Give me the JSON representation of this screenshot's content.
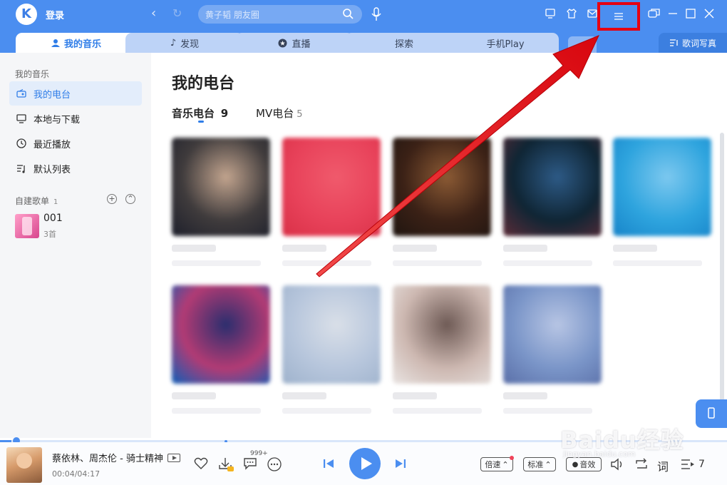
{
  "app": {
    "logo_letter": "K",
    "login_label": "登录"
  },
  "search": {
    "placeholder": "黄子韬 朋友圈"
  },
  "tabs": [
    {
      "label": "我的音乐",
      "active": true
    },
    {
      "label": "发现"
    },
    {
      "label": "直播"
    },
    {
      "label": "探索"
    },
    {
      "label": "手机Play"
    }
  ],
  "lyric_writing_label": "歌词写真",
  "sidebar": {
    "section_title": "我的音乐",
    "items": [
      {
        "label": "我的电台",
        "icon": "radio-icon",
        "active": true
      },
      {
        "label": "本地与下载",
        "icon": "monitor-icon"
      },
      {
        "label": "最近播放",
        "icon": "clock-icon"
      },
      {
        "label": "默认列表",
        "icon": "playlist-icon"
      }
    ],
    "created_playlists": {
      "title": "自建歌单",
      "count": "1"
    },
    "playlist": {
      "name": "001",
      "count": "3首"
    }
  },
  "main": {
    "title": "我的电台",
    "subtabs": [
      {
        "label": "音乐电台",
        "count": "9",
        "active": true
      },
      {
        "label": "MV电台",
        "count": "5"
      }
    ]
  },
  "cards": [
    {
      "colors": [
        "#3f3b3c",
        "#c2a48e",
        "#1d1f2b"
      ]
    },
    {
      "colors": [
        "#e8425a",
        "#f05a6c",
        "#d93047"
      ]
    },
    {
      "colors": [
        "#3b2116",
        "#8b5a34",
        "#1f1510"
      ]
    },
    {
      "colors": [
        "#0f2534",
        "#2d5a86",
        "#5c2c38"
      ]
    },
    {
      "colors": [
        "#2ea4de",
        "#7cc8ef",
        "#1784c9"
      ]
    },
    {
      "colors": [
        "#b23b74",
        "#2b2e6e",
        "#0e5eb8"
      ]
    },
    {
      "colors": [
        "#b7c6dc",
        "#d9dfe8",
        "#9eb2cc"
      ]
    },
    {
      "colors": [
        "#cdb8b1",
        "#6e5a55",
        "#e9e4e2"
      ]
    },
    {
      "colors": [
        "#7a95c8",
        "#b7c5e4",
        "#5a6fa8"
      ]
    }
  ],
  "player": {
    "song": "蔡依林、周杰伦 - 骑士精神",
    "time": "00:04/04:17",
    "progress": 0.016,
    "comment_count": "999+",
    "speed_label": "倍速",
    "quality_label": "标准",
    "effect_label": "音效",
    "lyric_label": "词",
    "queue_count": "7"
  },
  "colors": {
    "accent": "#4b8ef0",
    "highlight_box": "#e60012",
    "arrow": "#e8141c"
  },
  "watermark": {
    "text": "Baidu经验",
    "url": "jingyan.baidu.com"
  }
}
